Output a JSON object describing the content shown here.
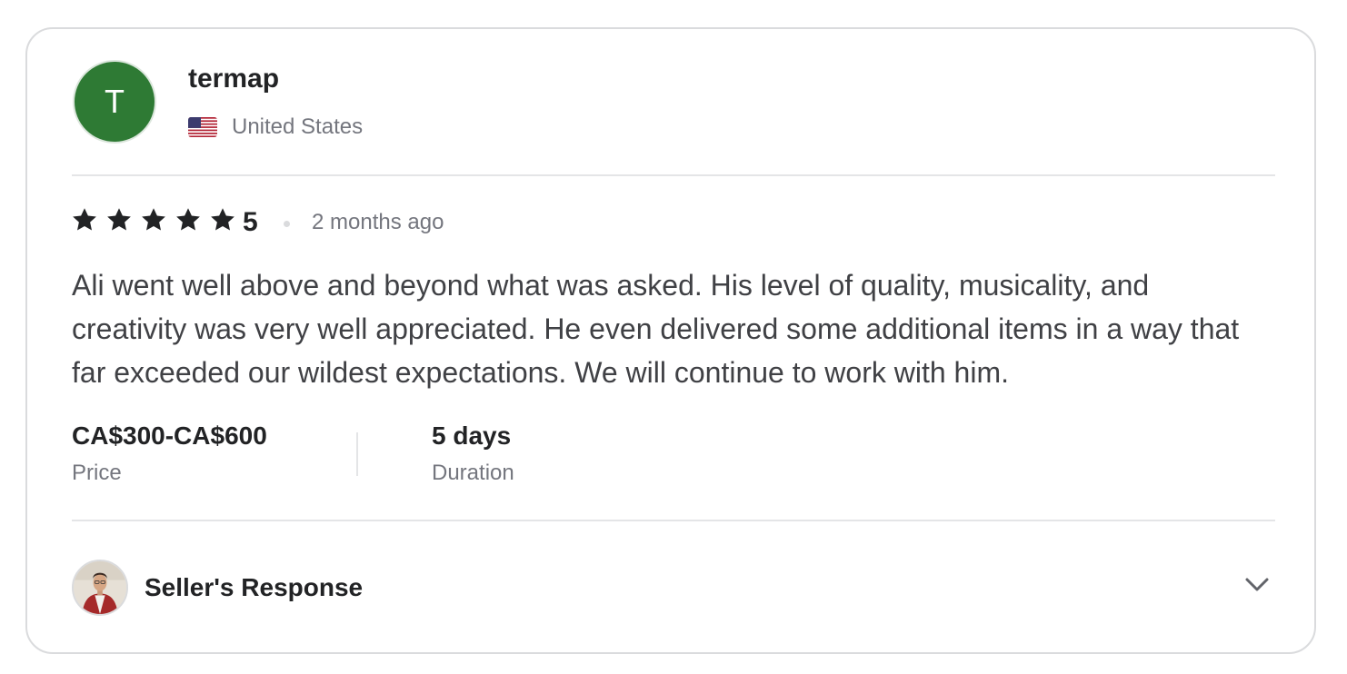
{
  "review": {
    "avatar_initial": "T",
    "username": "termap",
    "country": "United States",
    "rating": {
      "stars": 5,
      "value": "5"
    },
    "time_ago": "2 months ago",
    "text": "Ali went well above and beyond what was asked. His level of quality, musicality, and creativity was very well appreciated. He even delivered some additional items in a way that far exceeded our wildest expectations. We will continue to work with him.",
    "price": {
      "value": "CA$300-CA$600",
      "label": "Price"
    },
    "duration": {
      "value": "5 days",
      "label": "Duration"
    },
    "seller_response": {
      "label": "Seller's Response"
    }
  },
  "colors": {
    "avatar_bg": "#2e7a34",
    "star": "#222325",
    "muted_text": "#74767e",
    "border": "#dadbdd"
  },
  "icons": {
    "flag": "us-flag-icon",
    "star": "star-icon",
    "expand": "chevron-down-icon"
  }
}
